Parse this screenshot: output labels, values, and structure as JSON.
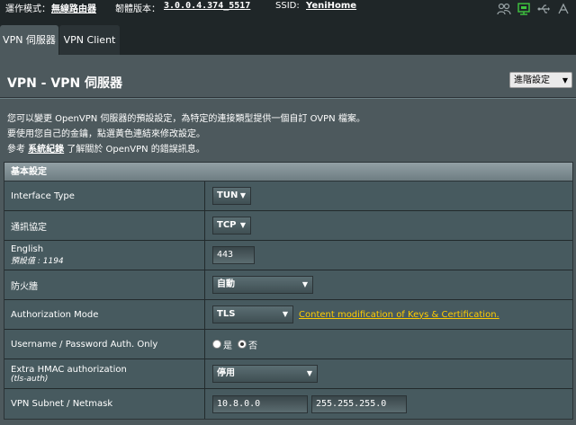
{
  "topbar": {
    "mode_label": "運作模式：",
    "mode_value": "無線路由器",
    "firmware_label": "韌體版本：",
    "firmware_value": "3.0.0.4.374_5517",
    "ssid_label": "SSID:",
    "ssid_value": "YeniHome"
  },
  "tabs": [
    {
      "label": "VPN 伺服器"
    },
    {
      "label": "VPN Client"
    }
  ],
  "header": {
    "title": "VPN - VPN 伺服器",
    "advanced_select": "進階設定"
  },
  "description": {
    "line1": "您可以變更 OpenVPN 伺服器的預設設定，為特定的連接類型提供一個自訂 OVPN 檔案。",
    "line2": "要使用您自己的金鑰，點選黃色連結來修改設定。",
    "line3_prefix": "參考 ",
    "line3_link": "系統紀錄",
    "line3_suffix": " 了解關於 OpenVPN 的錯誤訊息。"
  },
  "settings": {
    "section_title": "基本設定",
    "interface_type": {
      "label": "Interface Type",
      "value": "TUN"
    },
    "protocol": {
      "label": "通訊協定",
      "value": "TCP"
    },
    "port": {
      "label": "English",
      "sublabel": "預設值 : 1194",
      "value": "443"
    },
    "firewall": {
      "label": "防火牆",
      "value": "自動"
    },
    "auth_mode": {
      "label": "Authorization Mode",
      "value": "TLS",
      "link": "Content modification of Keys & Certification."
    },
    "userpass": {
      "label": "Username / Password Auth. Only",
      "yes": "是",
      "no": "否",
      "selected": "no"
    },
    "hmac": {
      "label": "Extra HMAC authorization",
      "sublabel": "(tls-auth)",
      "value": "停用"
    },
    "subnet": {
      "label": "VPN Subnet / Netmask",
      "subnet": "10.8.0.0",
      "netmask": "255.255.255.0"
    }
  },
  "colors": {
    "background": "#4d595d",
    "topbar": "#1f2628",
    "link_yellow": "#ffcc00"
  },
  "icons": [
    "users-icon",
    "network-icon",
    "usb-icon",
    "connection-icon"
  ]
}
